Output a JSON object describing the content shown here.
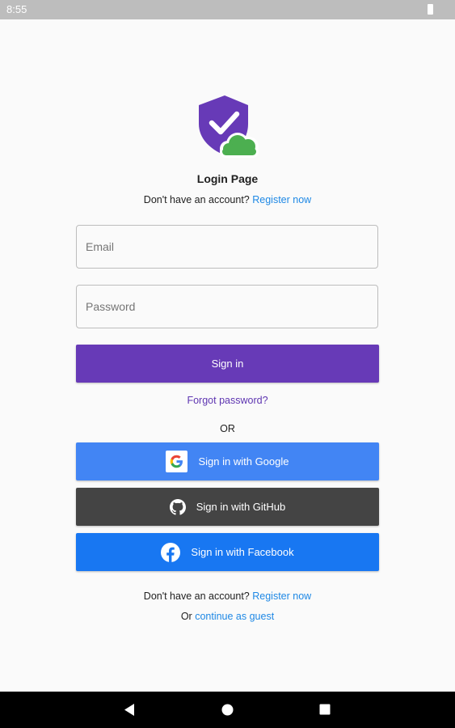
{
  "status_bar": {
    "time": "8:55"
  },
  "header": {
    "title": "Login Page",
    "register_prompt": "Don't have an account?",
    "register_link": "Register now"
  },
  "form": {
    "email_placeholder": "Email",
    "password_placeholder": "Password",
    "sign_in_label": "Sign in",
    "forgot_password": "Forgot password?"
  },
  "divider": {
    "or_label": "OR"
  },
  "social": {
    "google_label": "Sign in with Google",
    "github_label": "Sign in with GitHub",
    "facebook_label": "Sign in with Facebook"
  },
  "footer": {
    "register_prompt": "Don't have an account?",
    "register_link": "Register now",
    "or_prefix": "Or",
    "guest_link": "continue as guest"
  },
  "colors": {
    "primary": "#673ab7",
    "link": "#1e88e5",
    "google": "#4285f4",
    "github": "#444444",
    "facebook": "#1877f2",
    "logo_shield": "#673ab7",
    "logo_cloud": "#4caf50"
  },
  "icons": {
    "logo": "shield-check-cloud-icon",
    "google": "google-icon",
    "github": "github-icon",
    "facebook": "facebook-icon",
    "battery": "battery-icon",
    "back": "back-icon",
    "home": "home-icon",
    "recents": "recents-icon"
  }
}
